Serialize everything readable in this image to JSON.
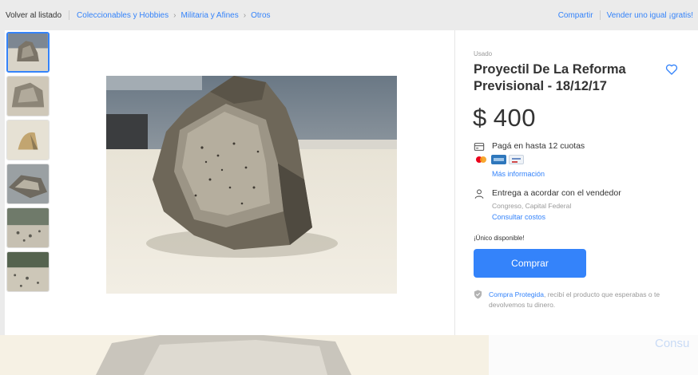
{
  "breadcrumb": {
    "back": "Volver al listado",
    "items": [
      "Coleccionables y Hobbies",
      "Militaria y Afines",
      "Otros"
    ]
  },
  "top_actions": {
    "share": "Compartir",
    "sell": "Vender uno igual ¡gratis!"
  },
  "product": {
    "condition": "Usado",
    "title": "Proyectil De La Reforma Previsional - 18/12/17",
    "currency": "$",
    "price": "400",
    "payment": {
      "text": "Pagá en hasta 12 cuotas",
      "more_info": "Más información",
      "cards": [
        "mastercard",
        "amex",
        "generic-card"
      ]
    },
    "shipping": {
      "text": "Entrega a acordar con el vendedor",
      "location": "Congreso, Capital Federal",
      "costs_link": "Consultar costos"
    },
    "stock": "¡Único disponible!",
    "buy_button": "Comprar",
    "protection": {
      "link": "Compra Protegida",
      "text": ", recibí el producto que esperabas o te devolvemos tu dinero."
    }
  },
  "footer_ghost": "Consu",
  "colors": {
    "accent": "#3483fa",
    "muted": "#999999",
    "text": "#333333"
  }
}
